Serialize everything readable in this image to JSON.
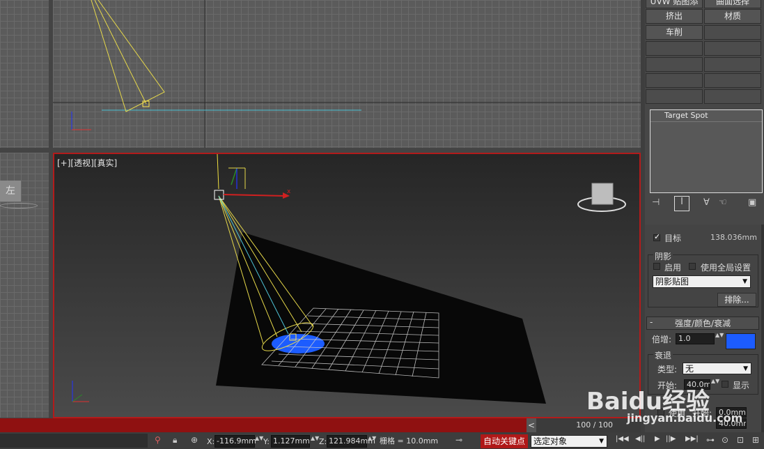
{
  "modifier_buttons": [
    {
      "left": "UVW 贴图添加",
      "right": "曲面选择"
    },
    {
      "left": "挤出",
      "right": "材质"
    },
    {
      "left": "车削",
      "right": ""
    },
    {
      "left": "",
      "right": ""
    },
    {
      "left": "",
      "right": ""
    },
    {
      "left": "",
      "right": ""
    },
    {
      "left": "",
      "right": ""
    }
  ],
  "modifier_stack": {
    "item": "Target Spot"
  },
  "viewport": {
    "label_plus": "[+]",
    "label_view": "[透视]",
    "label_shade": "[真实]",
    "axis_x": "x",
    "axis_z": "z",
    "left_view_cube": "左"
  },
  "params": {
    "target_label": "目标",
    "target_value": "138.036mm",
    "shadow_group": "阴影",
    "shadow_enable": "启用",
    "shadow_global": "使用全局设置",
    "shadow_type": "阴影贴图",
    "exclude_button": "排除...",
    "rollout_collapse": "-",
    "rollout_title": "强度/颜色/衰减",
    "multiplier_label": "倍增:",
    "multiplier_value": "1.0",
    "light_color": "#1c5cff",
    "decay_group": "衰退",
    "decay_type_label": "类型:",
    "decay_type_value": "无",
    "decay_start_label": "开始:",
    "decay_start_value": "40.0mm",
    "decay_show": "显示",
    "near_use": "使用",
    "near_start_label": "开始:",
    "near_start_value": "0.0mm",
    "near_end_value": "40.0mm"
  },
  "timeline": {
    "frame": "100 / 100",
    "scroll_left": "<"
  },
  "status": {
    "x_label": "X:",
    "x_value": "-116.9mm",
    "y_label": "Y:",
    "y_value": "1.127mm",
    "z_label": "Z:",
    "z_value": "121.984mm",
    "grid": "栅格 = 10.0mm",
    "autokey": "自动关键点",
    "selection": "选定对象"
  },
  "playback": [
    "|◀◀",
    "◀||",
    "▶",
    "||▶",
    "▶▶|"
  ],
  "watermark": {
    "brand": "Baidu经验",
    "url": "jingyan.baidu.com"
  }
}
